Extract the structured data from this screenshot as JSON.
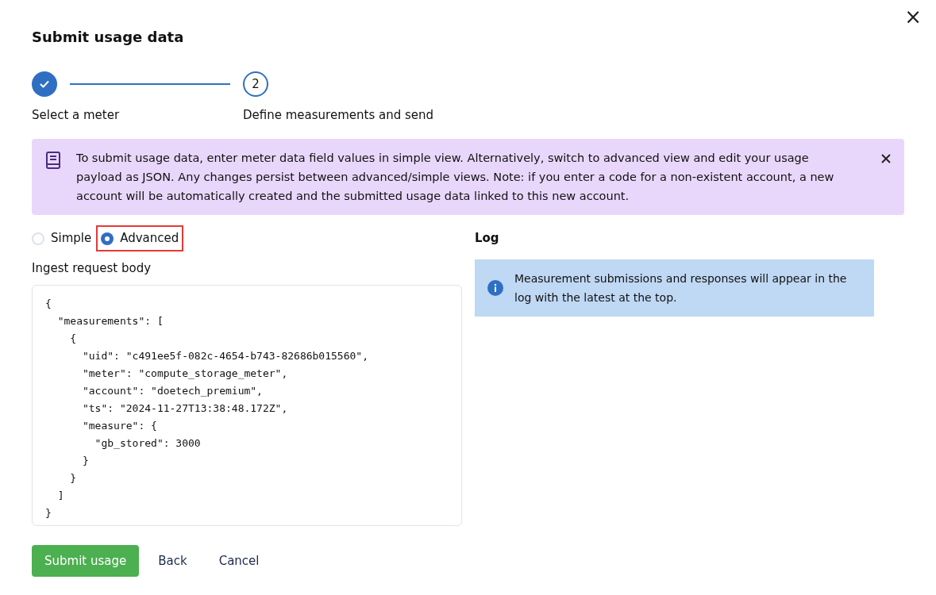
{
  "dialog": {
    "title": "Submit usage data",
    "close_symbol": "×"
  },
  "stepper": [
    {
      "label": "Select a meter",
      "completed": true
    },
    {
      "label": "Define measurements and send",
      "number": "2",
      "completed": false
    }
  ],
  "notice": {
    "text": "To submit usage data, enter meter data field values in simple view. Alternatively, switch to advanced view and edit your usage payload as JSON. Any changes persist between advanced/simple views. Note: if you enter a code for a non-existent account, a new account will be automatically created and the submitted usage data linked to this new account."
  },
  "view_options": [
    {
      "label": "Simple",
      "selected": false,
      "highlighted": false
    },
    {
      "label": "Advanced",
      "selected": true,
      "highlighted": true
    }
  ],
  "request_body": {
    "label": "Ingest request body",
    "lines": [
      "{",
      "  \"measurements\": [",
      "    {",
      "      \"uid\": \"c491ee5f-082c-4654-b743-82686b015560\",",
      "      \"meter\": \"compute_storage_meter\",",
      "      \"account\": \"doetech_premium\",",
      "      \"ts\": \"2024-11-27T13:38:48.172Z\",",
      "      \"measure\": {",
      "        \"gb_stored\": 3000",
      "      }",
      "    }",
      "  ]",
      "}"
    ]
  },
  "log": {
    "title": "Log",
    "info": "Measurement submissions and responses will appear in the log with the latest at the top."
  },
  "buttons": [
    {
      "label": "Submit usage",
      "kind": "primary"
    },
    {
      "label": "Back",
      "kind": "text"
    },
    {
      "label": "Cancel",
      "kind": "text"
    }
  ]
}
